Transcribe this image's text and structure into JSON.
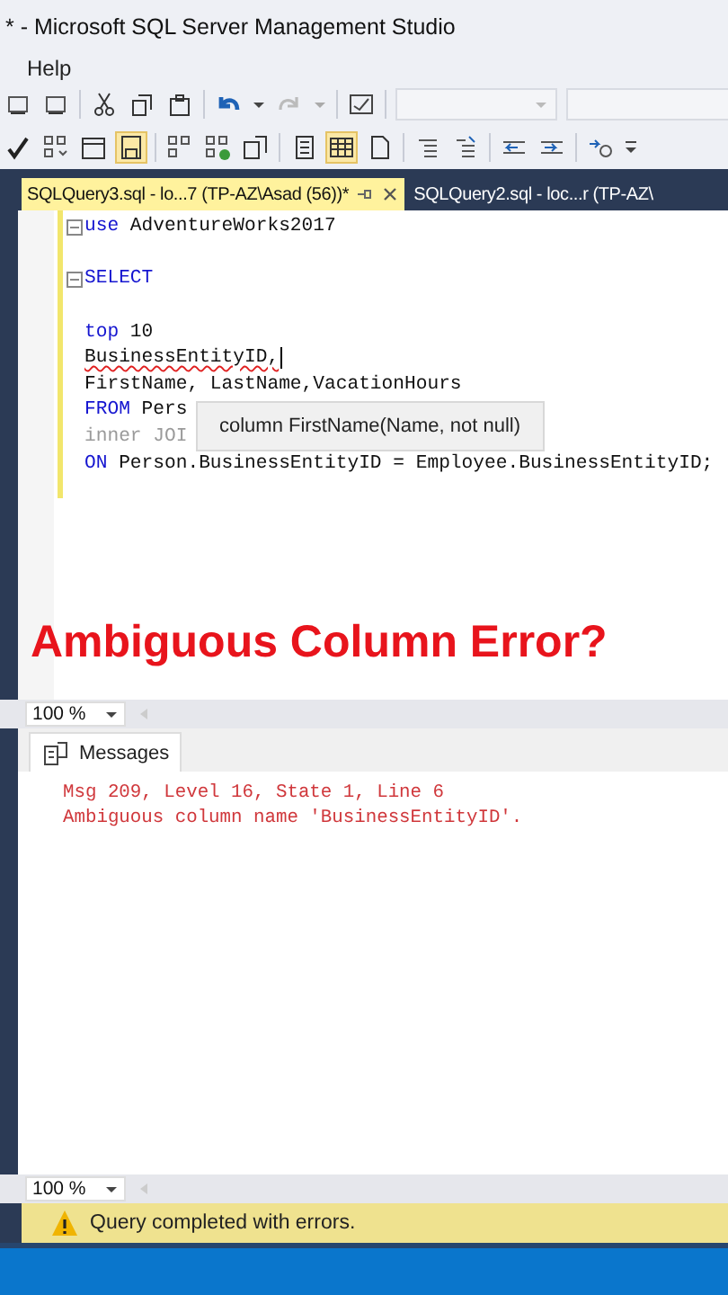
{
  "window": {
    "title": "* - Microsoft SQL Server Management Studio"
  },
  "menu": [
    {
      "label": "Help"
    }
  ],
  "tabs": [
    {
      "label": "SQLQuery3.sql - lo...7 (TP-AZ\\Asad (56))*",
      "selected": true
    },
    {
      "label": "SQLQuery2.sql - loc...r (TP-AZ\\",
      "selected": false
    }
  ],
  "editor": {
    "lines": [
      {
        "kind": "code",
        "fold_marker": true,
        "tokens": [
          {
            "kind": "keyword",
            "text": "use"
          },
          {
            "kind": "plain",
            "text": " AdventureWorks2017"
          }
        ]
      },
      {
        "kind": "blank"
      },
      {
        "kind": "code",
        "fold_marker": true,
        "tokens": [
          {
            "kind": "keyword",
            "text": "SELECT"
          }
        ]
      },
      {
        "kind": "blank"
      },
      {
        "kind": "code",
        "fold_marker": false,
        "tokens": [
          {
            "kind": "keyword",
            "text": "top"
          },
          {
            "kind": "plain",
            "text": " 10"
          }
        ]
      },
      {
        "kind": "code",
        "fold_marker": false,
        "caret": true,
        "tokens": [
          {
            "kind": "error",
            "text": "BusinessEntityID,"
          }
        ]
      },
      {
        "kind": "code",
        "fold_marker": false,
        "tokens": [
          {
            "kind": "plain",
            "text": "FirstName, LastName,VacationHours"
          }
        ]
      },
      {
        "kind": "code",
        "fold_marker": false,
        "tokens": [
          {
            "kind": "keyword",
            "text": "FROM"
          },
          {
            "kind": "plain",
            "text": " Pers"
          }
        ]
      },
      {
        "kind": "code",
        "fold_marker": false,
        "tokens": [
          {
            "kind": "faded",
            "text": "inner JOI"
          }
        ]
      },
      {
        "kind": "code",
        "fold_marker": false,
        "tokens": [
          {
            "kind": "keyword",
            "text": "ON"
          },
          {
            "kind": "plain",
            "text": " Person.BusinessEntityID = Employee.BusinessEntityID;"
          }
        ]
      }
    ],
    "tooltip": "column FirstName(Name, not null)",
    "caption": "Ambiguous Column Error?",
    "zoom": "100 %"
  },
  "results": {
    "tabs": [
      {
        "label": "Messages",
        "selected": true
      }
    ],
    "messages": [
      "Msg 209, Level 16, State 1, Line 6",
      "Ambiguous column name 'BusinessEntityID'."
    ],
    "zoom": "100 %"
  },
  "status_bar": {
    "kind": "warning",
    "text": "Query completed with errors."
  }
}
